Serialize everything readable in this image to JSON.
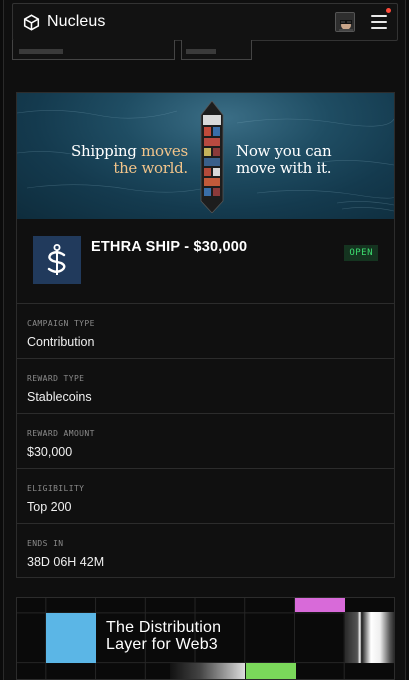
{
  "header": {
    "brand": "Nucleus",
    "icons": {
      "logo": "nucleus-cube-icon",
      "menu": "hamburger-menu-icon"
    },
    "notification_color": "#ff4a3a"
  },
  "hero": {
    "left_line1_plain": "Shipping ",
    "left_line1_accent": "moves",
    "left_line2": "the world.",
    "right_line1": "Now you can",
    "right_line2": "move with it."
  },
  "campaign": {
    "title": "ETHRA SHIP - $30,000",
    "status": "OPEN",
    "status_color": "#3ddc6f",
    "token_icon": "dollar-anchor-icon",
    "details": [
      {
        "label": "CAMPAIGN TYPE",
        "value": "Contribution"
      },
      {
        "label": "REWARD TYPE",
        "value": "Stablecoins"
      },
      {
        "label": "REWARD AMOUNT",
        "value": "$30,000"
      },
      {
        "label": "ELIGIBILITY",
        "value": "Top 200"
      },
      {
        "label": "ENDS IN",
        "value": "38D 06H 42M"
      }
    ]
  },
  "promo": {
    "line1": "The Distribution",
    "line2": "Layer for Web3",
    "colors": {
      "blue": "#5bb6e6",
      "pink": "#d86ad9",
      "green": "#7ad85a"
    }
  }
}
